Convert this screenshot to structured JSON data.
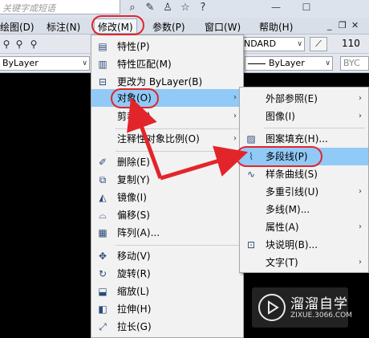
{
  "search": {
    "placeholder": "关键字或短语"
  },
  "titlebar": {
    "icons": [
      "binoculars-icon",
      "wrench-icon",
      "user-icon",
      "star-icon",
      "help-icon"
    ],
    "help_glyph": "?",
    "window_minimize": "—",
    "window_maximize": "☐"
  },
  "menubar": {
    "items": [
      "绘图(D)",
      "标注(N)",
      "修改(M)",
      "参数(P)",
      "窗口(W)",
      "帮助(H)"
    ],
    "mdi_buttons": [
      "_",
      "❐",
      "✕"
    ]
  },
  "toolbar": {
    "dimstyle_value": "NDARD",
    "scale_value": "110",
    "layer_left": "ByLayer",
    "layer_right": "ByLayer",
    "plotstyle": "BYC"
  },
  "modify_menu": {
    "items": [
      {
        "label": "特性(P)",
        "icon": "properties-icon",
        "submenu": false
      },
      {
        "label": "特性匹配(M)",
        "icon": "match-properties-icon",
        "submenu": false
      },
      {
        "label": "更改为 ByLayer(B)",
        "icon": "change-bylayer-icon",
        "submenu": false
      },
      {
        "label": "对象(O)",
        "icon": "",
        "submenu": true,
        "highlighted": true
      },
      {
        "label": "剪裁(C)",
        "icon": "",
        "submenu": true
      },
      {
        "label": "注释性对象比例(O)",
        "icon": "",
        "submenu": true
      },
      {
        "label": "删除(E)",
        "icon": "erase-icon",
        "submenu": false
      },
      {
        "label": "复制(Y)",
        "icon": "copy-icon",
        "submenu": false
      },
      {
        "label": "镜像(I)",
        "icon": "mirror-icon",
        "submenu": false
      },
      {
        "label": "偏移(S)",
        "icon": "offset-icon",
        "submenu": false
      },
      {
        "label": "阵列(A)...",
        "icon": "array-icon",
        "submenu": false
      },
      {
        "label": "移动(V)",
        "icon": "move-icon",
        "submenu": false
      },
      {
        "label": "旋转(R)",
        "icon": "rotate-icon",
        "submenu": false
      },
      {
        "label": "缩放(L)",
        "icon": "scale-icon",
        "submenu": false
      },
      {
        "label": "拉伸(H)",
        "icon": "stretch-icon",
        "submenu": false
      },
      {
        "label": "拉长(G)",
        "icon": "lengthen-icon",
        "submenu": false
      }
    ]
  },
  "object_submenu": {
    "items": [
      {
        "label": "外部参照(E)",
        "icon": "",
        "submenu": true
      },
      {
        "label": "图像(I)",
        "icon": "",
        "submenu": true
      },
      {
        "label": "图案填充(H)...",
        "icon": "hatch-edit-icon",
        "submenu": false
      },
      {
        "label": "多段线(P)",
        "icon": "polyline-edit-icon",
        "submenu": false,
        "highlighted": true
      },
      {
        "label": "样条曲线(S)",
        "icon": "spline-edit-icon",
        "submenu": false
      },
      {
        "label": "多重引线(U)",
        "icon": "",
        "submenu": true
      },
      {
        "label": "多线(M)...",
        "icon": "",
        "submenu": false
      },
      {
        "label": "属性(A)",
        "icon": "",
        "submenu": true
      },
      {
        "label": "块说明(B)...",
        "icon": "block-description-icon",
        "submenu": false
      },
      {
        "label": "文字(T)",
        "icon": "",
        "submenu": true
      }
    ]
  },
  "watermark": {
    "brand": "溜溜自学",
    "url": "ZIXUE.3066.COM"
  },
  "colors": {
    "highlight": "#91c9f7",
    "annotation_red": "#e2252b",
    "menu_bg": "#f2f2f2"
  }
}
